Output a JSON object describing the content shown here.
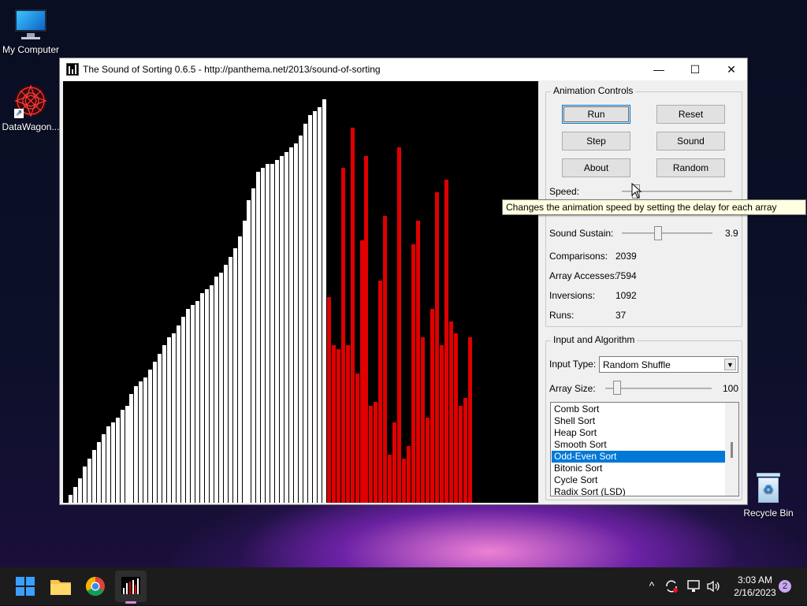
{
  "desktop": {
    "icons": [
      {
        "label": "My Computer"
      },
      {
        "label": "DataWagon..."
      },
      {
        "label": "Recycle Bin"
      }
    ]
  },
  "window": {
    "title": "The Sound of Sorting 0.6.5 - http://panthema.net/2013/sound-of-sorting",
    "minimize": "—",
    "maximize": "☐",
    "close": "✕"
  },
  "animation": {
    "legend": "Animation Controls",
    "buttons": {
      "run": "Run",
      "reset": "Reset",
      "step": "Step",
      "sound": "Sound",
      "about": "About",
      "random": "Random"
    },
    "speed_label": "Speed:",
    "speed_level": 0.12,
    "tooltip": "Changes the animation speed by setting the delay for each array access.",
    "sustain_label": "Sound Sustain:",
    "sustain_value": "3.9",
    "sustain_level": 0.39,
    "stats": [
      {
        "label": "Comparisons:",
        "value": "2039"
      },
      {
        "label": "Array Accesses:",
        "value": "7594"
      },
      {
        "label": "Inversions:",
        "value": "1092"
      },
      {
        "label": "Runs:",
        "value": "37"
      }
    ]
  },
  "input_algo": {
    "legend": "Input and Algorithm",
    "input_type_label": "Input Type:",
    "input_type_value": "Random Shuffle",
    "array_size_label": "Array Size:",
    "array_size_value": "100",
    "array_size_level": 0.08,
    "algorithms": [
      "Comb Sort",
      "Shell Sort",
      "Heap Sort",
      "Smooth Sort",
      "Odd-Even Sort",
      "Bitonic Sort",
      "Cycle Sort",
      "Radix Sort (LSD)"
    ],
    "selected_index": 4
  },
  "colors": {
    "bar_default": "#ffffff",
    "bar_active": "#e00000",
    "selection": "#0078d7"
  },
  "array_values": [
    2,
    4,
    6,
    9,
    11,
    13,
    15,
    17,
    19,
    20,
    21,
    23,
    24,
    27,
    29,
    30,
    31,
    33,
    35,
    37,
    39,
    41,
    42,
    44,
    46,
    48,
    49,
    50,
    52,
    53,
    54,
    56,
    57,
    59,
    61,
    63,
    66,
    70,
    75,
    78,
    82,
    83,
    84,
    84,
    85,
    86,
    87,
    88,
    89,
    91,
    94,
    96,
    97,
    98,
    100,
    51,
    39,
    38,
    83,
    39,
    93,
    32,
    65,
    86,
    24,
    25,
    55,
    71,
    12,
    20,
    88,
    11,
    14,
    64,
    70,
    41,
    21,
    48,
    77,
    39,
    80,
    45,
    42,
    24,
    26,
    41
  ],
  "array_active_start": 55,
  "taskbar": {
    "time": "3:03 AM",
    "date": "2/16/2023",
    "notification_count": "2",
    "chevron": "^"
  }
}
